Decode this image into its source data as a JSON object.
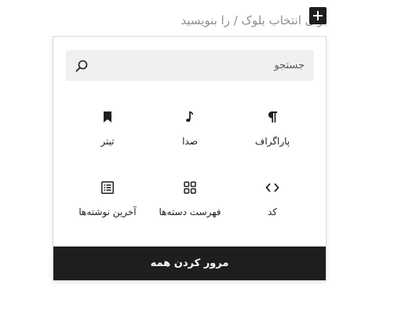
{
  "editor": {
    "placeholder_text": "برای انتخاب بلوک / را بنویسید",
    "add_block_symbol": "+"
  },
  "inserter": {
    "search": {
      "placeholder": "جستجو",
      "value": "",
      "icon": "search-icon"
    },
    "blocks": [
      {
        "label": "پاراگراف",
        "icon": "paragraph-icon"
      },
      {
        "label": "صدا",
        "icon": "audio-icon"
      },
      {
        "label": "تیتر",
        "icon": "heading-icon"
      },
      {
        "label": "کد",
        "icon": "code-icon"
      },
      {
        "label": "فهرست دسته‌ها",
        "icon": "categories-icon"
      },
      {
        "label": "آخرین نوشته‌ها",
        "icon": "latest-posts-icon"
      }
    ],
    "browse_all_label": "مرور کردن همه"
  },
  "colors": {
    "dark": "#1e1e1e",
    "search_bg": "#f0f0f0",
    "placeholder_gray": "#8f8f8f"
  }
}
